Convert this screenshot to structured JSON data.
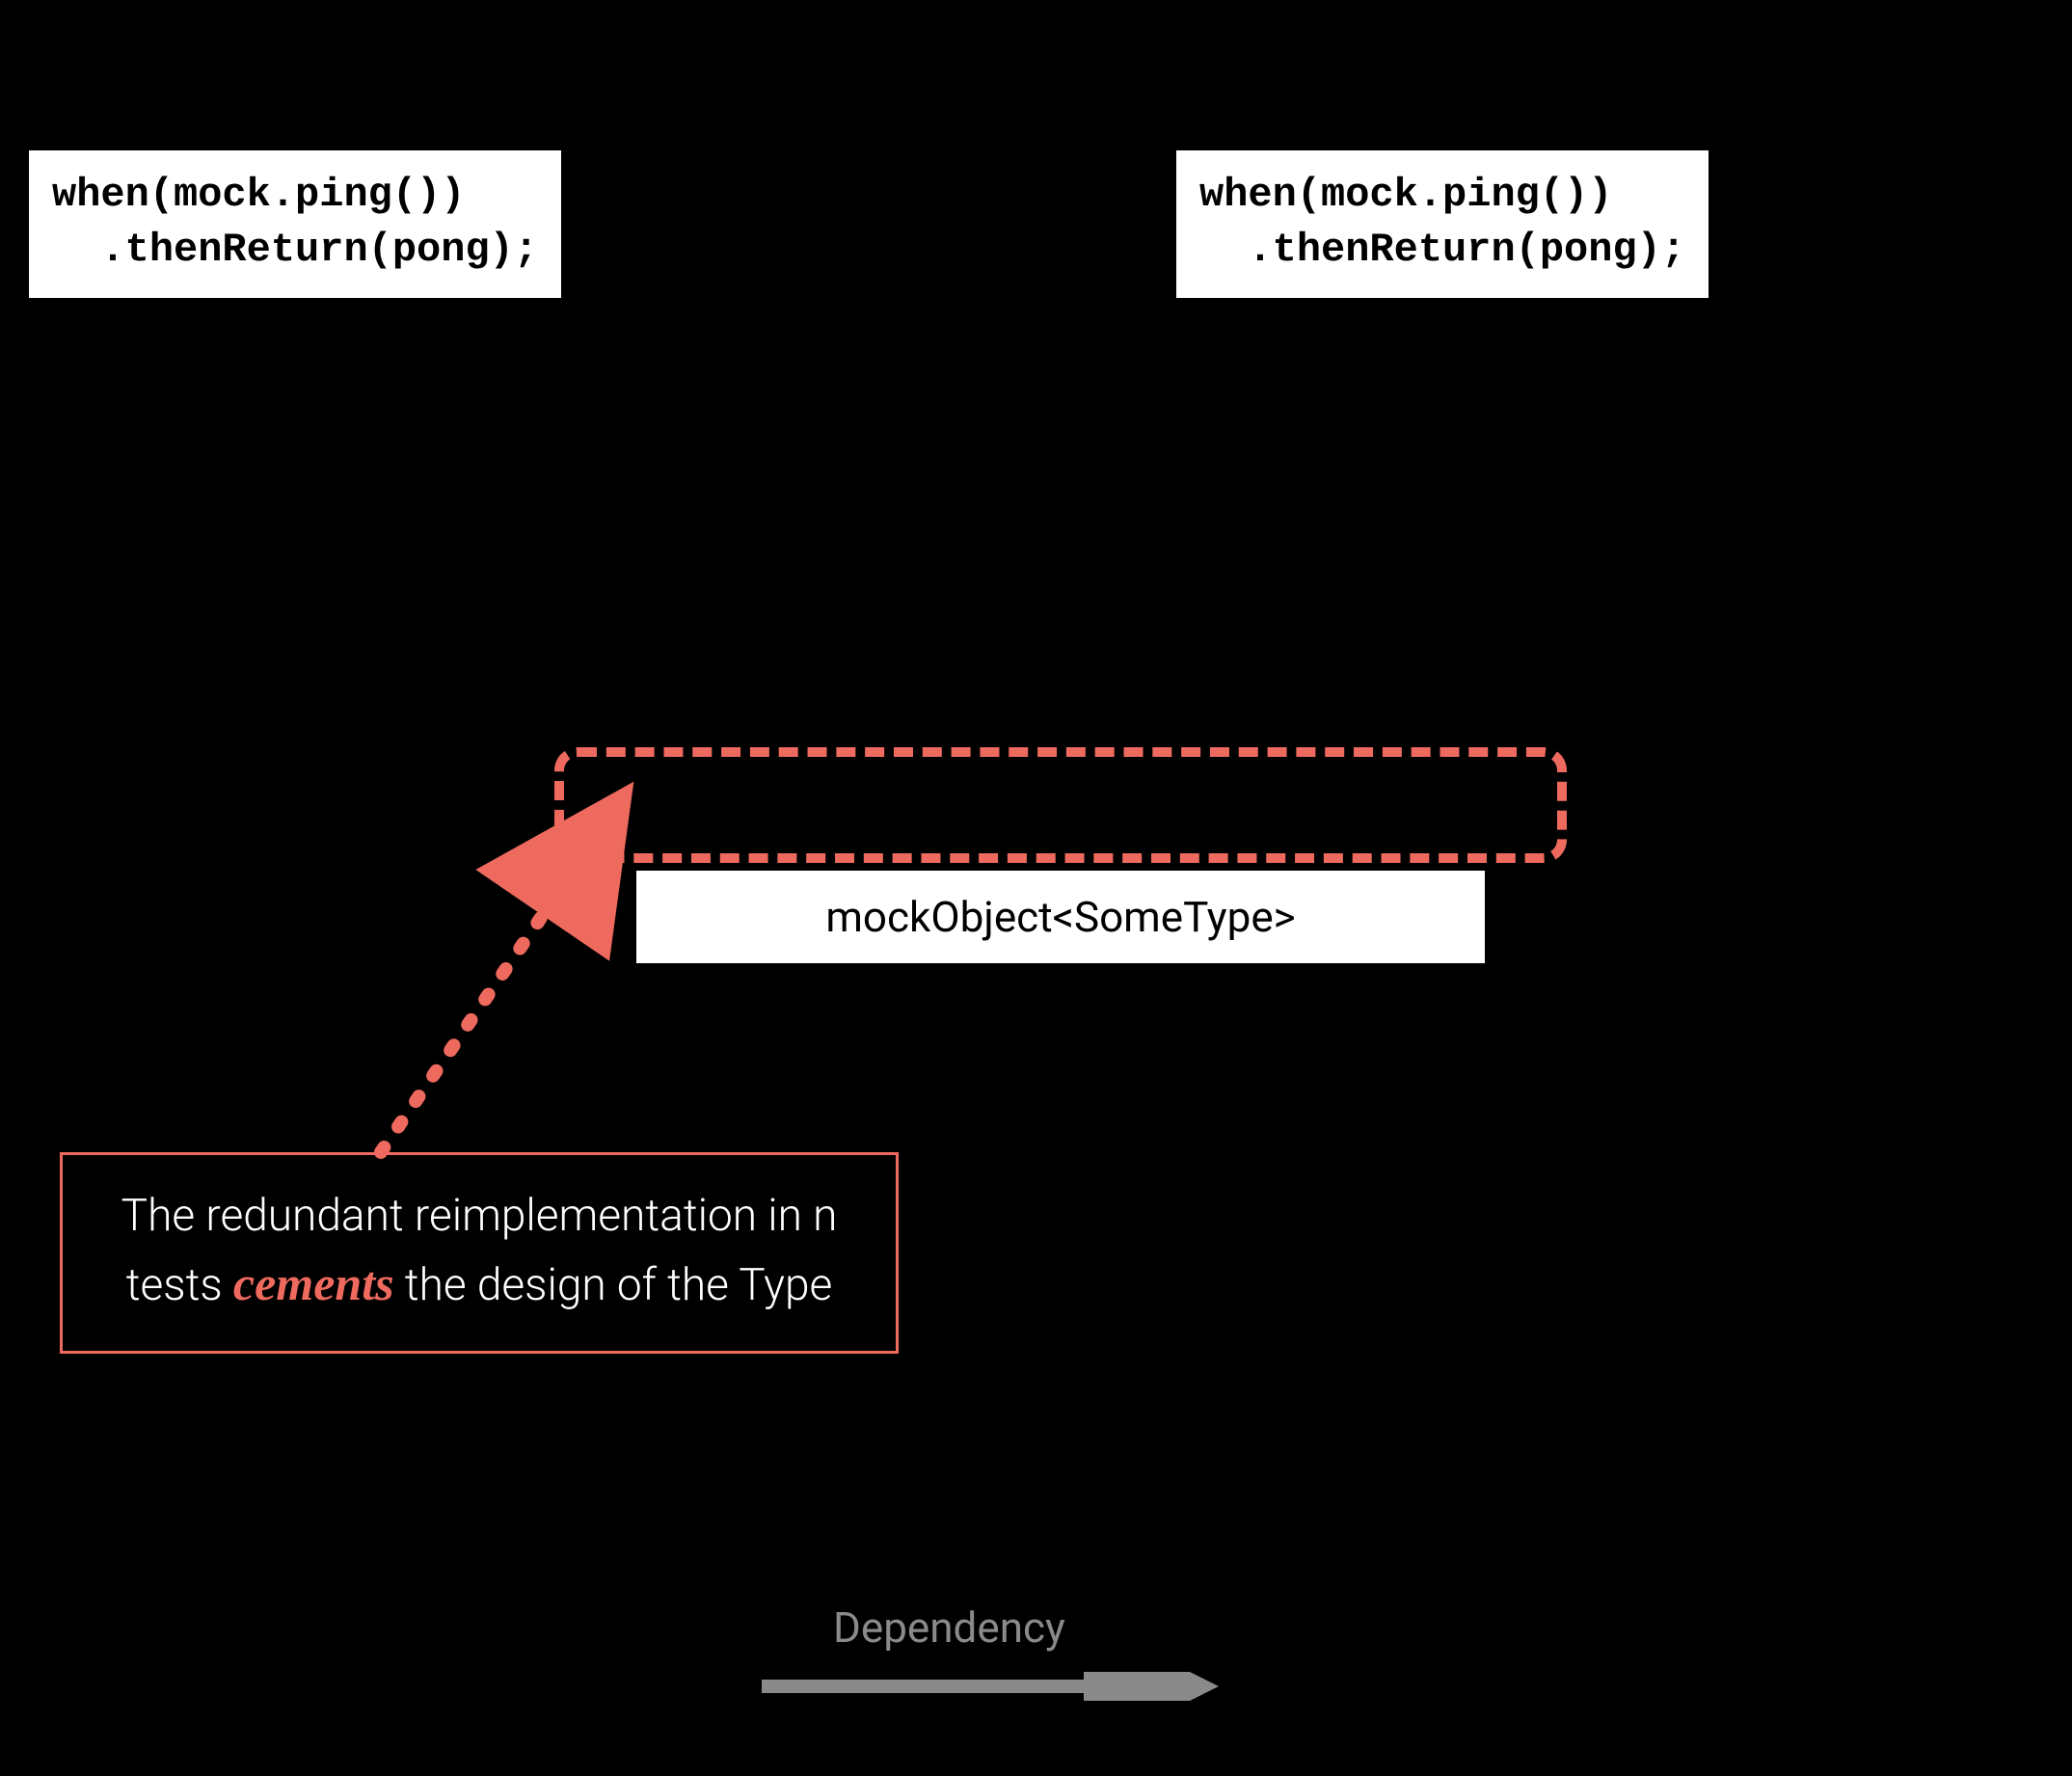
{
  "code_left": "when(mock.ping())\n  .thenReturn(pong);",
  "code_right": "when(mock.ping())\n  .thenReturn(pong);",
  "mock_label": "mockObject<SomeType>",
  "annotation_pre": "The redundant reimplementation in n tests ",
  "annotation_em": "cements",
  "annotation_post": "  the design of the Type",
  "legend": "Dependency",
  "colors": {
    "accent": "#ee6a5e",
    "grey": "#8a8a8a"
  }
}
